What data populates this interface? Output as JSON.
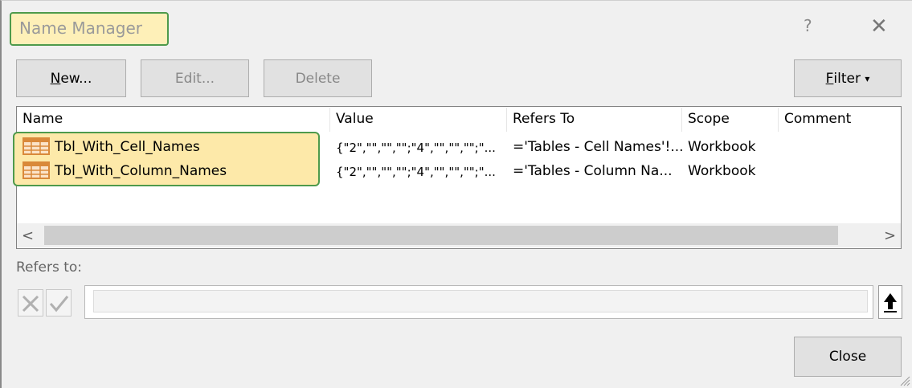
{
  "dialog": {
    "title": "Name Manager",
    "help_label": "?",
    "close_glyph": "✕"
  },
  "toolbar": {
    "new_prefix": "",
    "new_accel": "N",
    "new_rest": "ew...",
    "edit_label": "Edit...",
    "delete_label": "Delete",
    "filter_accel": "F",
    "filter_rest": "ilter",
    "filter_arrow": "▾"
  },
  "list": {
    "columns": [
      "Name",
      "Value",
      "Refers To",
      "Scope",
      "Comment"
    ],
    "rows": [
      {
        "name": "Tbl_With_Cell_Names",
        "value": "{\"2\",\"\",\"\",\"\";\"4\",\"\",\"\",\"\";\"...",
        "refers_to": "='Tables - Cell Names'!...",
        "scope": "Workbook",
        "comment": ""
      },
      {
        "name": "Tbl_With_Column_Names",
        "value": "{\"2\",\"\",\"\",\"\";\"4\",\"\",\"\",\"\";\"...",
        "refers_to": "='Tables - Column Na...",
        "scope": "Workbook",
        "comment": ""
      }
    ],
    "scroll_left": "<",
    "scroll_right": ">"
  },
  "refers": {
    "label": "Refers to:",
    "value": "",
    "collapse_glyph": "🡅"
  },
  "footer": {
    "close_label": "Close"
  },
  "colors": {
    "highlight_fill": "#fde9a9",
    "highlight_border": "#4e9a4c",
    "icon_orange": "#d9893a"
  },
  "icons": {
    "row_icon": "table-icon"
  }
}
